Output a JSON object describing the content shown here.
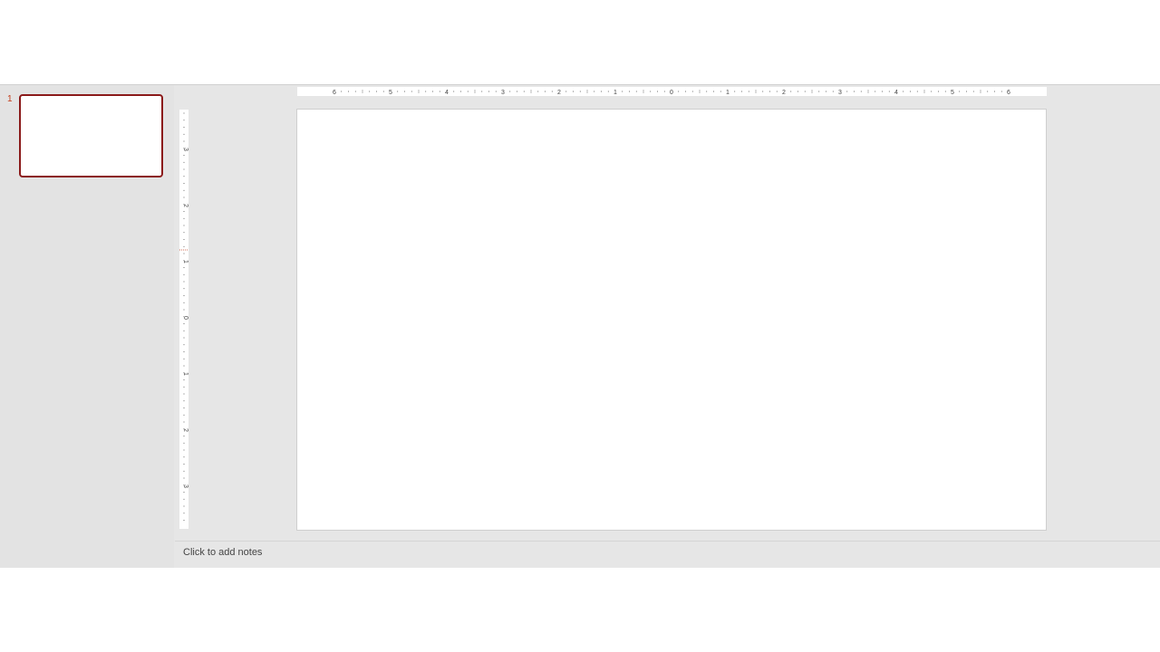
{
  "thumbnails": {
    "slides": [
      {
        "number": "1"
      }
    ]
  },
  "rulers": {
    "horizontal_labels": [
      "6",
      "5",
      "4",
      "3",
      "2",
      "1",
      "0",
      "1",
      "2",
      "3",
      "4",
      "5",
      "6"
    ],
    "vertical_labels": [
      "3",
      "2",
      "1",
      "0",
      "1",
      "2",
      "3"
    ]
  },
  "notes": {
    "placeholder": "Click to add notes"
  },
  "colors": {
    "accent": "#8b1a1a",
    "slide_number": "#c43e1c",
    "pane_background": "#e6e6e6"
  }
}
